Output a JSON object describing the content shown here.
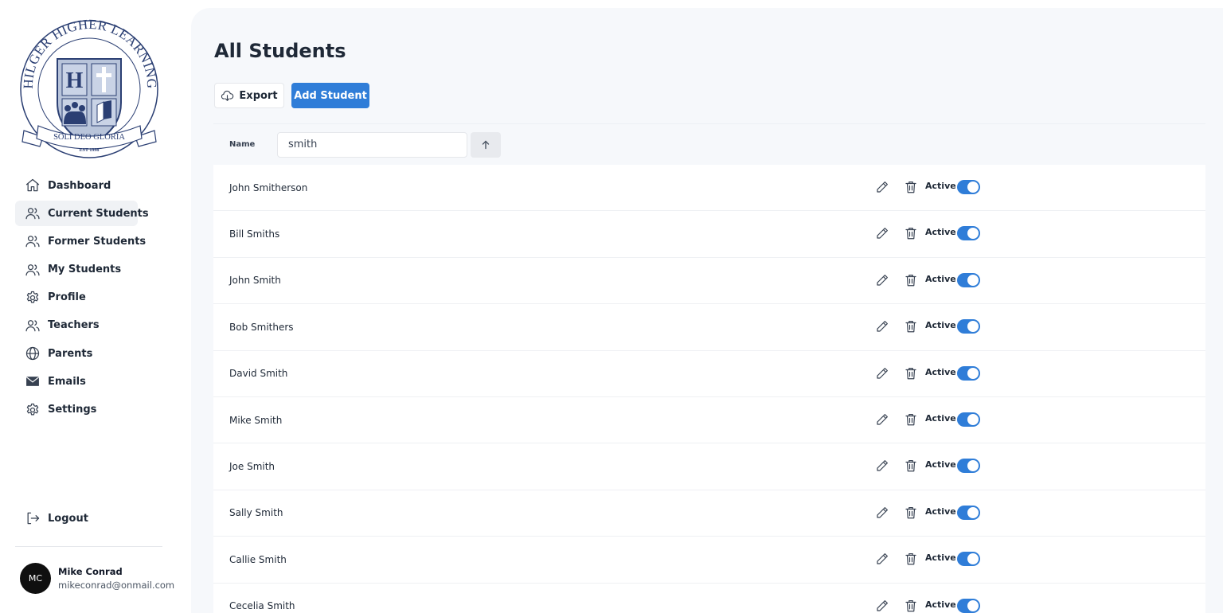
{
  "logo": {
    "arc_text": "HILGER HIGHER LEARNING",
    "banner_text": "SOLI DEO GLORIA",
    "est_text": "EST 1998",
    "shield_letter": "H"
  },
  "sidebar": {
    "items": [
      {
        "label": "Dashboard",
        "icon": "home-icon",
        "active": false
      },
      {
        "label": "Current Students",
        "icon": "users-icon",
        "active": true
      },
      {
        "label": "Former Students",
        "icon": "users-icon",
        "active": false
      },
      {
        "label": "My Students",
        "icon": "users-icon",
        "active": false
      },
      {
        "label": "Profile",
        "icon": "gear-icon",
        "active": false
      },
      {
        "label": "Teachers",
        "icon": "users-icon",
        "active": false
      },
      {
        "label": "Parents",
        "icon": "globe-icon",
        "active": false
      },
      {
        "label": "Emails",
        "icon": "mail-icon",
        "active": false
      },
      {
        "label": "Settings",
        "icon": "gear-icon",
        "active": false
      }
    ],
    "logout_label": "Logout"
  },
  "user": {
    "initials": "MC",
    "name": "Mike Conrad",
    "email": "mikeconrad@onmail.com"
  },
  "main": {
    "title": "All Students",
    "export_label": "Export",
    "add_label": "Add Student",
    "filter": {
      "label": "Name",
      "value": "smith"
    },
    "students": [
      {
        "name": "John Smitherson",
        "status": "Active",
        "enabled": true
      },
      {
        "name": "Bill Smiths",
        "status": "Active",
        "enabled": true
      },
      {
        "name": "John Smith",
        "status": "Active",
        "enabled": true
      },
      {
        "name": "Bob Smithers",
        "status": "Active",
        "enabled": true
      },
      {
        "name": "David Smith",
        "status": "Active",
        "enabled": true
      },
      {
        "name": "Mike Smith",
        "status": "Active",
        "enabled": true
      },
      {
        "name": "Joe Smith",
        "status": "Active",
        "enabled": true
      },
      {
        "name": "Sally Smith",
        "status": "Active",
        "enabled": true
      },
      {
        "name": "Callie Smith",
        "status": "Active",
        "enabled": true
      },
      {
        "name": "Cecelia Smith",
        "status": "Active",
        "enabled": true
      }
    ]
  },
  "colors": {
    "accent": "#2f7dd8",
    "logo_navy": "#2b3f73",
    "main_bg": "#f6f8fb"
  }
}
